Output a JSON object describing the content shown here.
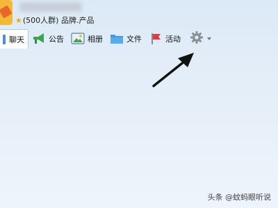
{
  "header": {
    "group_info": "(500人群) 品牌.产品",
    "avatar_icon": "group-avatar-icon",
    "star_icon": "star-icon"
  },
  "tabs": [
    {
      "id": "chat",
      "label": "聊天",
      "icon": "chat-icon",
      "active": true
    },
    {
      "id": "notice",
      "label": "公告",
      "icon": "megaphone-icon",
      "active": false
    },
    {
      "id": "album",
      "label": "相册",
      "icon": "photo-icon",
      "active": false
    },
    {
      "id": "files",
      "label": "文件",
      "icon": "folder-icon",
      "active": false
    },
    {
      "id": "activity",
      "label": "活动",
      "icon": "flag-icon",
      "active": false
    }
  ],
  "settings": {
    "icon": "gear-icon",
    "dropdown_icon": "chevron-down-icon"
  },
  "annotation": {
    "icon": "arrow-pointer-icon",
    "color": "#111111"
  },
  "watermark": "头条 @蚊蚂眼听说",
  "colors": {
    "background": "#e4eef8",
    "accent_green": "#3aa64a",
    "folder_blue": "#3d9be0",
    "flag_red": "#e23a3a",
    "star": "#f2a900"
  }
}
